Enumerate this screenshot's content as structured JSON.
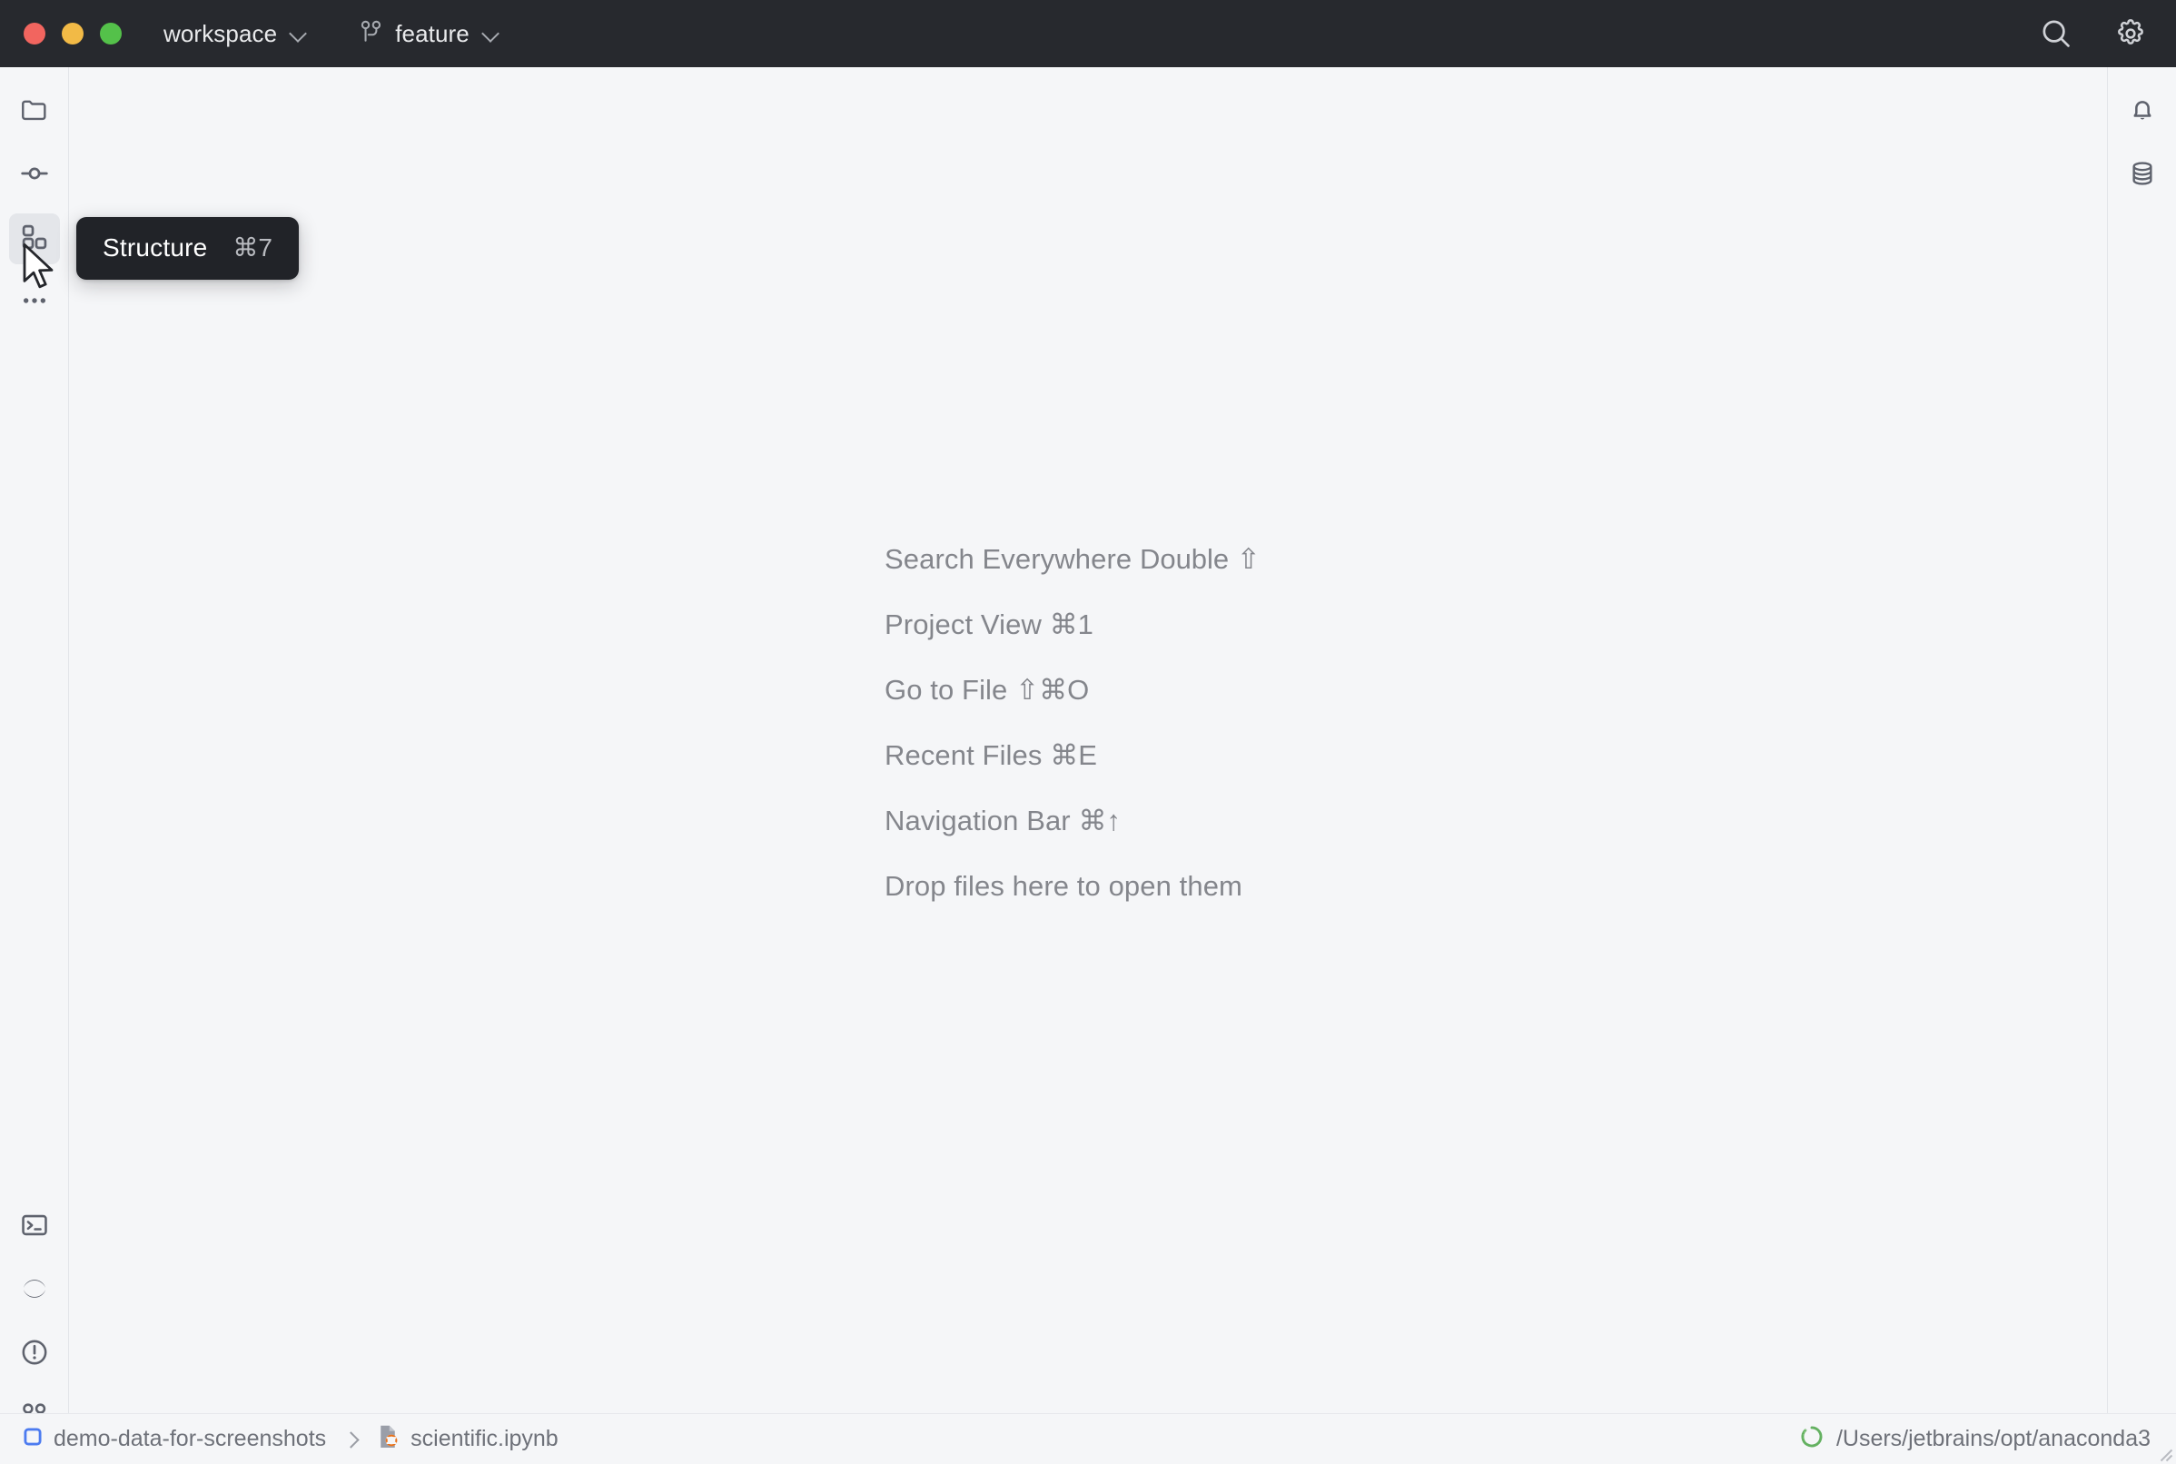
{
  "window": {
    "traffic_lights": [
      {
        "name": "close",
        "color": "#F2655F"
      },
      {
        "name": "minimize",
        "color": "#F2BA46"
      },
      {
        "name": "zoom",
        "color": "#54C14A"
      }
    ],
    "project_name": "workspace",
    "branch_name": "feature",
    "titlebar_bg": "#27292E",
    "search_icon": "search-icon",
    "settings_icon": "gear-icon"
  },
  "left_toolbar": {
    "top_items": [
      {
        "id": "project",
        "icon": "folder-icon",
        "selected": false
      },
      {
        "id": "commit",
        "icon": "commit-icon",
        "selected": false
      },
      {
        "id": "structure",
        "icon": "structure-icon",
        "selected": true
      },
      {
        "id": "more",
        "icon": "more-horizontal-icon",
        "selected": false
      }
    ],
    "bottom_items": [
      {
        "id": "terminal",
        "icon": "terminal-icon",
        "selected": false
      },
      {
        "id": "python-console",
        "icon": "python-console-icon",
        "selected": false
      },
      {
        "id": "problems",
        "icon": "problems-icon",
        "selected": false
      },
      {
        "id": "version-control",
        "icon": "branch-icon",
        "selected": false
      }
    ]
  },
  "right_toolbar": {
    "items": [
      {
        "id": "notifications",
        "icon": "bell-icon"
      },
      {
        "id": "database",
        "icon": "database-icon"
      }
    ]
  },
  "tooltip": {
    "label": "Structure",
    "shortcut": "⌘7",
    "bg": "#212328",
    "text_color": "#FFFFFF"
  },
  "editor": {
    "hints": [
      {
        "text": "Search Everywhere",
        "keys": "Double ⇧"
      },
      {
        "text": "Project View",
        "keys": "⌘1"
      },
      {
        "text": "Go to File",
        "keys": "⇧⌘O"
      },
      {
        "text": "Recent Files",
        "keys": "⌘E"
      },
      {
        "text": "Navigation Bar",
        "keys": "⌘↑"
      },
      {
        "text": "Drop files here to open them",
        "keys": ""
      }
    ],
    "hint_color": "#84868C",
    "background": "#F5F6F8"
  },
  "status_bar": {
    "breadcrumbs": [
      {
        "label": "demo-data-for-screenshots",
        "icon": "project-square-icon"
      },
      {
        "label": "scientific.ipynb",
        "icon": "jupyter-notebook-icon"
      }
    ],
    "interpreter": {
      "label": "/Users/jetbrains/opt/anaconda3",
      "icon": "conda-icon",
      "icon_color": "#64B161"
    }
  }
}
